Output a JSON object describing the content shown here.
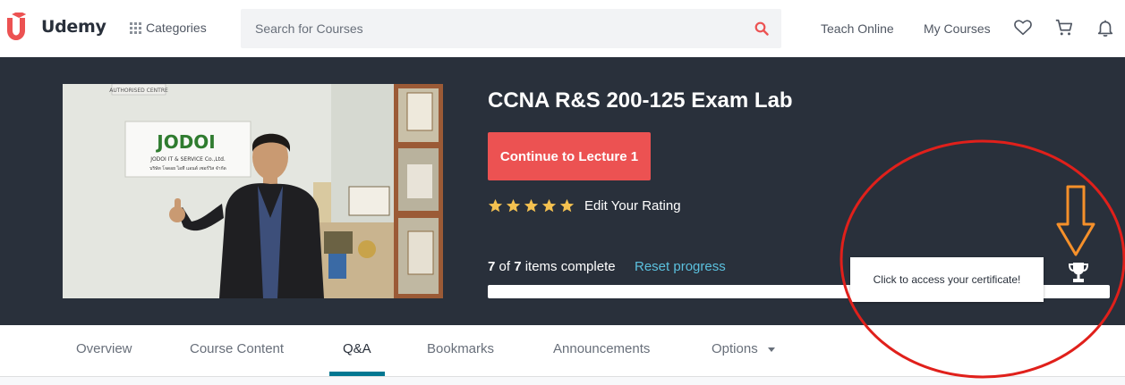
{
  "header": {
    "logo_text": "Udemy",
    "categories_label": "Categories",
    "search_placeholder": "Search for Courses",
    "teach_label": "Teach Online",
    "my_courses_label": "My Courses"
  },
  "course": {
    "title": "CCNA R&S 200-125 Exam Lab",
    "continue_label": "Continue to Lecture 1",
    "rating_stars": 5,
    "rating_label": "Edit Your Rating",
    "completed": "7",
    "total": "7",
    "of_text": "of",
    "items_complete_text": "items complete",
    "reset_label": "Reset progress",
    "progress_fraction": 1.0,
    "tooltip": "Click to access your certificate!",
    "thumbnail": {
      "sign_text": "AUTHORISED CENTRE",
      "company_name": "JODOI IT & SERVICE Co.,Ltd.",
      "company_thai": "บริษัท โจดอย ไอที แอนด์ เซอร์วิส จำกัด"
    }
  },
  "tabs": [
    {
      "label": "Overview",
      "active": false
    },
    {
      "label": "Course Content",
      "active": false
    },
    {
      "label": "Q&A",
      "active": true
    },
    {
      "label": "Bookmarks",
      "active": false
    },
    {
      "label": "Announcements",
      "active": false
    },
    {
      "label": "Options",
      "active": false
    }
  ],
  "colors": {
    "accent": "#ec5252",
    "hero_bg": "#29303b",
    "link": "#5bc0de",
    "star": "#f4c150",
    "tab_active": "#007791",
    "annotation_red": "#e0201b",
    "annotation_orange": "#f5902a"
  },
  "icons": [
    "udemy-logo-icon",
    "grid-icon",
    "search-icon",
    "heart-icon",
    "cart-icon",
    "bell-icon",
    "star-icon",
    "trophy-icon",
    "caret-down-icon"
  ]
}
